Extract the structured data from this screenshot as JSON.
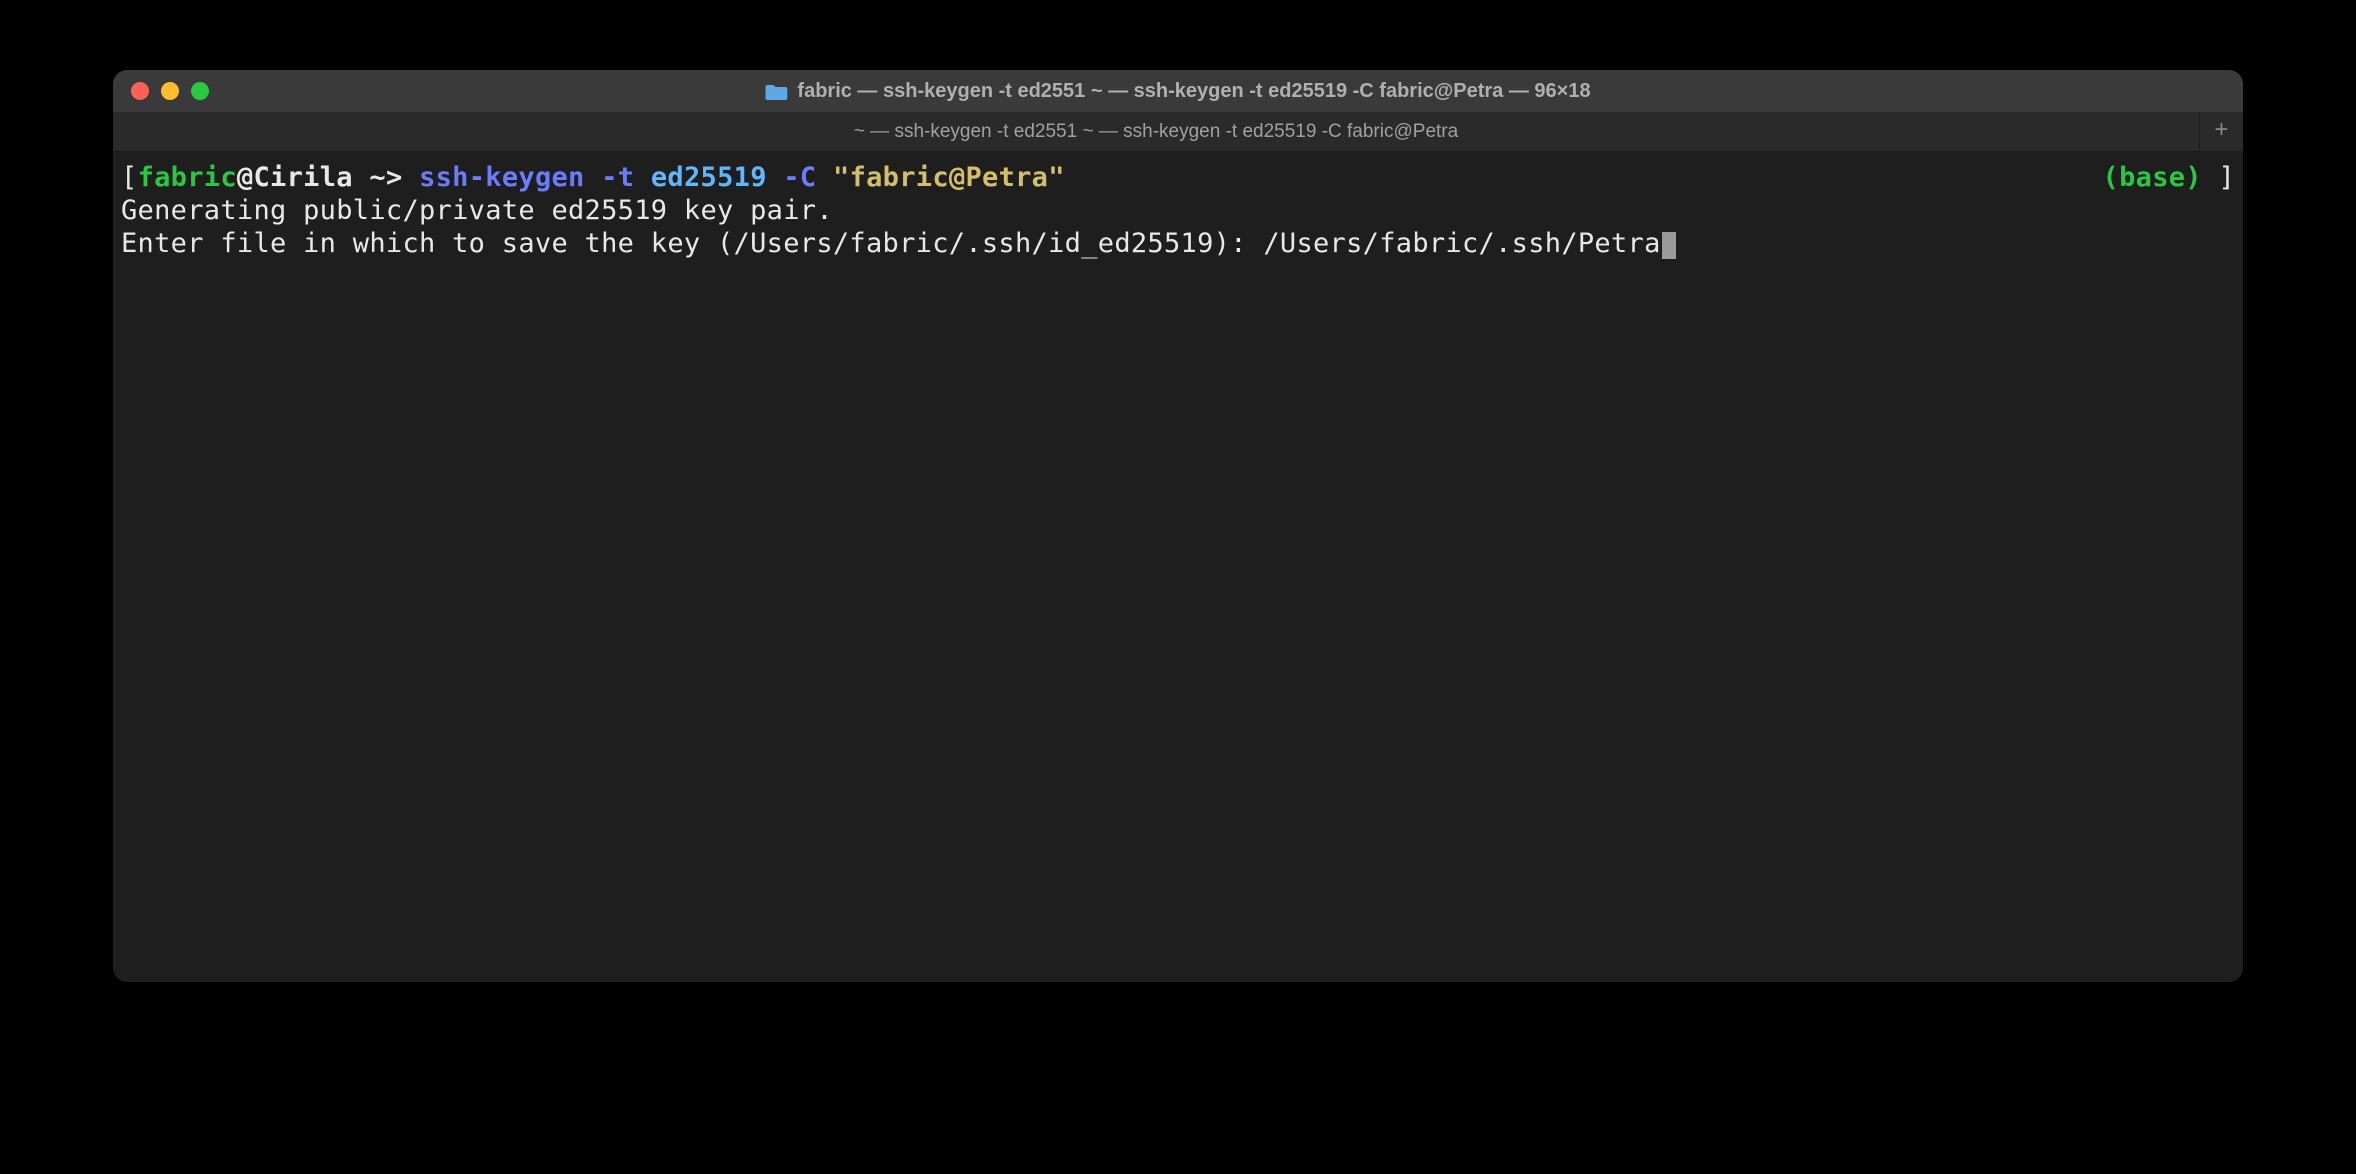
{
  "titlebar": {
    "title": "fabric — ssh-keygen -t ed2551 ~ — ssh-keygen -t ed25519 -C fabric@Petra — 96×18"
  },
  "tabbar": {
    "tab_label": "~ — ssh-keygen -t ed2551 ~ — ssh-keygen -t ed25519 -C fabric@Petra",
    "new_tab": "+"
  },
  "prompt": {
    "open_bracket": "[",
    "user": "fabric",
    "at": "@",
    "host": "Cirila",
    "path": " ~",
    "arrow": ">",
    "cmd": "ssh-keygen",
    "flag1": "-t",
    "arg1": "ed25519",
    "flag2": "-C",
    "string": "\"fabric@Petra\"",
    "env": "(base)",
    "close_bracket": "]"
  },
  "output": {
    "line1": "Generating public/private ed25519 key pair.",
    "line2_prompt": "Enter file in which to save the key (/Users/fabric/.ssh/id_ed25519): ",
    "line2_input": "/Users/fabric/.ssh/Petra"
  }
}
